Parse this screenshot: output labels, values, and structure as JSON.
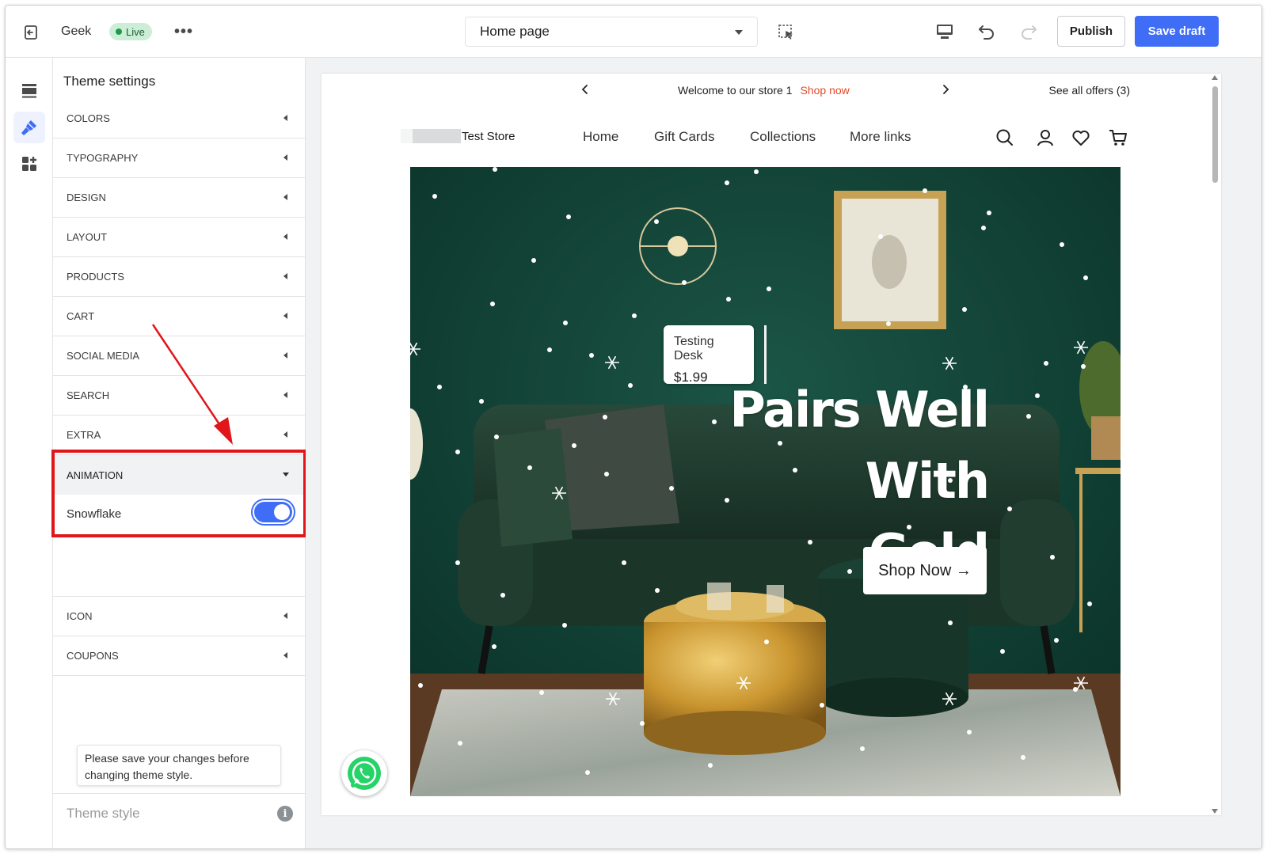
{
  "topbar": {
    "store_name": "Geek",
    "status_badge": "Live",
    "more_label": "•••",
    "page_selector": "Home page",
    "publish_label": "Publish",
    "save_label": "Save draft",
    "accent_color": "#3f6df5"
  },
  "rail": {
    "icons": [
      "sections-icon",
      "theme-brush-icon",
      "apps-icon"
    ],
    "active": "theme-brush-icon"
  },
  "panel": {
    "title": "Theme settings",
    "sections": [
      {
        "label": "COLORS"
      },
      {
        "label": "TYPOGRAPHY"
      },
      {
        "label": "DESIGN"
      },
      {
        "label": "LAYOUT"
      },
      {
        "label": "PRODUCTS"
      },
      {
        "label": "CART"
      },
      {
        "label": "SOCIAL MEDIA"
      },
      {
        "label": "SEARCH"
      },
      {
        "label": "EXTRA"
      },
      {
        "label": "ANIMATION",
        "open": true
      },
      {
        "label": "ICON"
      },
      {
        "label": "COUPONS"
      }
    ],
    "animation_toggle": {
      "label": "Snowflake",
      "on": true
    },
    "save_note": "Please save your changes before changing theme style.",
    "theme_style_label": "Theme style",
    "highlight_color": "#e0161b"
  },
  "preview": {
    "announcement": {
      "text": "Welcome to our store 1",
      "link": "Shop now",
      "offers": "See all offers (3)"
    },
    "store_title": "Test Store",
    "nav": [
      "Home",
      "Gift Cards",
      "Collections",
      "More links"
    ],
    "header_icons": [
      "search-icon",
      "account-icon",
      "wishlist-heart-icon",
      "cart-icon"
    ],
    "hero": {
      "product_tag_name": "Testing Desk",
      "product_tag_price": "$1.99",
      "heading_line1": "Pairs Well With",
      "heading_line2": "Gold",
      "button_label": "Shop Now →"
    }
  }
}
